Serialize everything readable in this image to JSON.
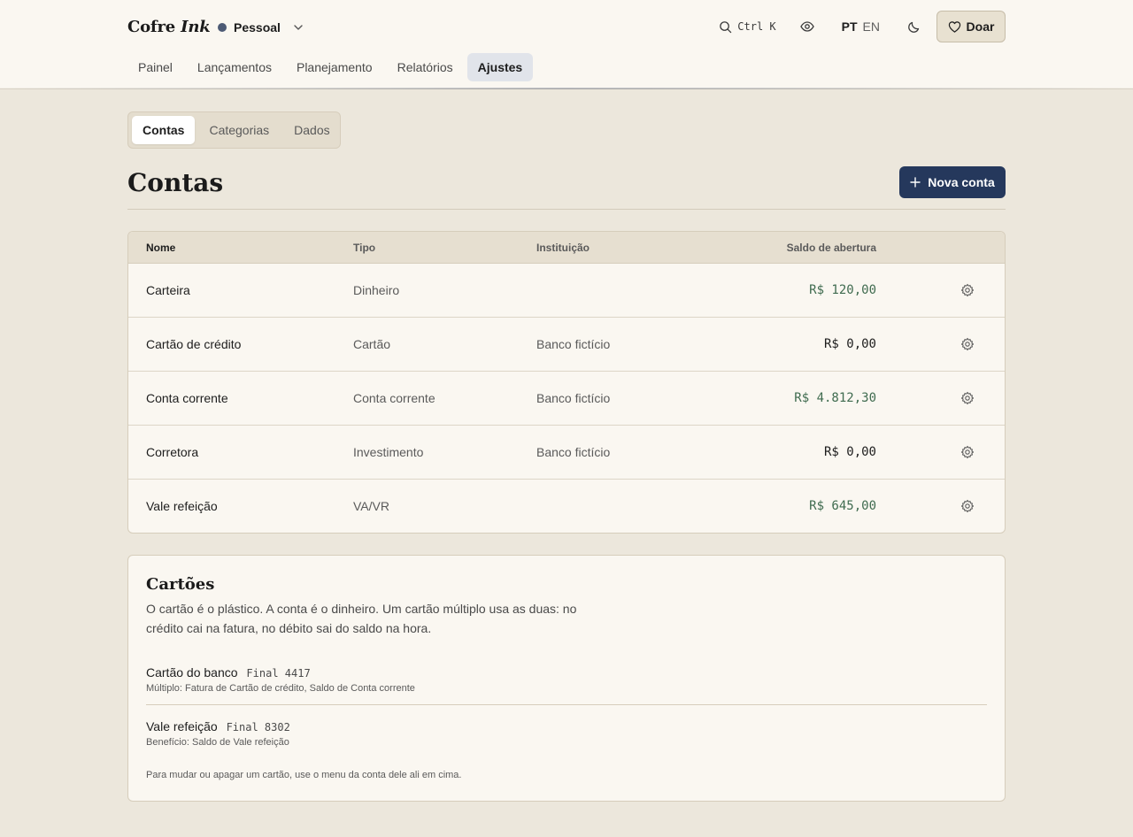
{
  "app": {
    "brand_main": "Cofre",
    "brand_italic": "Ink",
    "workspace_name": "Pessoal",
    "workspace_color": "#4c5a75",
    "search_shortcut": "Ctrl K",
    "languages": {
      "active": "PT",
      "other": "EN"
    },
    "donate_label": "Doar"
  },
  "nav": {
    "items": [
      {
        "label": "Painel",
        "active": false
      },
      {
        "label": "Lançamentos",
        "active": false
      },
      {
        "label": "Planejamento",
        "active": false
      },
      {
        "label": "Relatórios",
        "active": false
      },
      {
        "label": "Ajustes",
        "active": true
      }
    ]
  },
  "subtabs": {
    "items": [
      {
        "label": "Contas",
        "active": true
      },
      {
        "label": "Categorias",
        "active": false
      },
      {
        "label": "Dados",
        "active": false
      }
    ]
  },
  "page": {
    "title": "Contas",
    "new_button": "Nova conta"
  },
  "table": {
    "headers": {
      "name": "Nome",
      "type": "Tipo",
      "institution": "Instituição",
      "balance": "Saldo de abertura"
    },
    "rows": [
      {
        "name": "Carteira",
        "type": "Dinheiro",
        "institution": "",
        "balance": "R$ 120,00",
        "positive": true
      },
      {
        "name": "Cartão de crédito",
        "type": "Cartão",
        "institution": "Banco fictício",
        "balance": "R$ 0,00",
        "positive": false
      },
      {
        "name": "Conta corrente",
        "type": "Conta corrente",
        "institution": "Banco fictício",
        "balance": "R$ 4.812,30",
        "positive": true
      },
      {
        "name": "Corretora",
        "type": "Investimento",
        "institution": "Banco fictício",
        "balance": "R$ 0,00",
        "positive": false
      },
      {
        "name": "Vale refeição",
        "type": "VA/VR",
        "institution": "",
        "balance": "R$ 645,00",
        "positive": true
      }
    ]
  },
  "cards": {
    "title": "Cartões",
    "description": "O cartão é o plástico. A conta é o dinheiro. Um cartão múltiplo usa as duas: no crédito cai na fatura, no débito sai do saldo na hora.",
    "items": [
      {
        "name": "Cartão do banco",
        "suffix": "Final 4417",
        "detail": "Múltiplo: Fatura de Cartão de crédito, Saldo de Conta corrente"
      },
      {
        "name": "Vale refeição",
        "suffix": "Final 8302",
        "detail": "Benefício: Saldo de Vale refeição"
      }
    ],
    "footnote": "Para mudar ou apagar um cartão, use o menu da conta dele ali em cima."
  },
  "colors": {
    "accent": "#25385c",
    "positive_balance": "#3f6b4f",
    "neutral_balance": "#1d1d1d",
    "background": "#ece7dc",
    "surface": "#faf7f1"
  }
}
